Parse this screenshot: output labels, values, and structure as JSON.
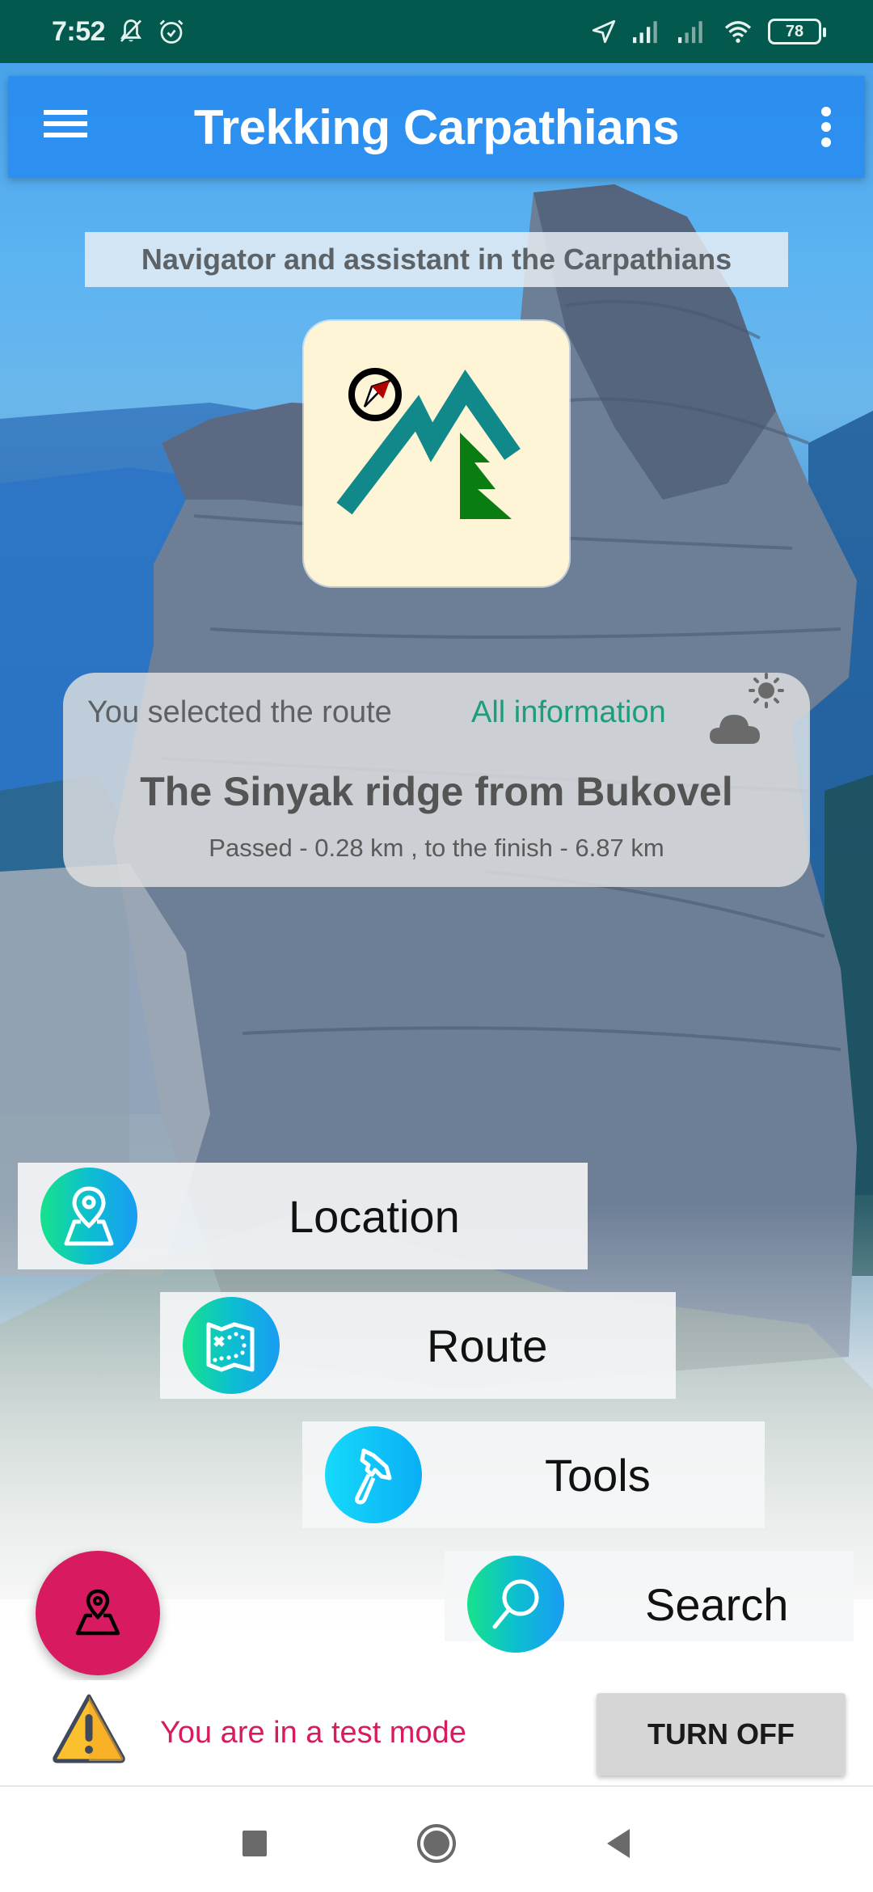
{
  "status_bar": {
    "time": "7:52",
    "icons_left": [
      "notifications-muted-icon",
      "alarm-icon"
    ],
    "icons_right": [
      "location-arrow-icon",
      "signal-sim1-icon",
      "signal-sim2-icon",
      "wifi-icon",
      "battery-icon"
    ],
    "battery_level": "78"
  },
  "app_bar": {
    "title": "Trekking Carpathians",
    "menu_icon": "hamburger-menu-icon",
    "overflow_icon": "more-vert-icon",
    "background_color": "#288cf0"
  },
  "subtitle": "Navigator and assistant in the Carpathians",
  "logo": {
    "icon": "mountain-compass-tree-logo",
    "colors": {
      "mountain": "#11898a",
      "tree": "#0a7d12",
      "compass_needle": "#b00000",
      "background": "#fdf5d6"
    }
  },
  "route_card": {
    "selected_label": "You selected the route",
    "all_info_link": "All information",
    "weather_icon": "partly-sunny-cloud-icon",
    "route_name": "The Sinyak ridge from Bukovel",
    "progress_text": "Passed - 0.28 km , to the finish - 6.87 km",
    "link_color": "#1e9c7e"
  },
  "menu": [
    {
      "label": "Location",
      "icon": "location-map-pin-icon"
    },
    {
      "label": "Route",
      "icon": "treasure-map-icon"
    },
    {
      "label": "Tools",
      "icon": "axe-icon"
    },
    {
      "label": "Search",
      "icon": "magnifier-icon"
    }
  ],
  "fab": {
    "icon": "my-location-map-icon",
    "color": "#d81b60"
  },
  "test_mode": {
    "icon": "warning-triangle-icon",
    "message": "You are in a test mode",
    "button_label": "TURN OFF",
    "message_color": "#d81b60"
  },
  "nav_bar": {
    "recents_icon": "square-recents-icon",
    "home_icon": "circle-home-icon",
    "back_icon": "triangle-back-icon"
  }
}
